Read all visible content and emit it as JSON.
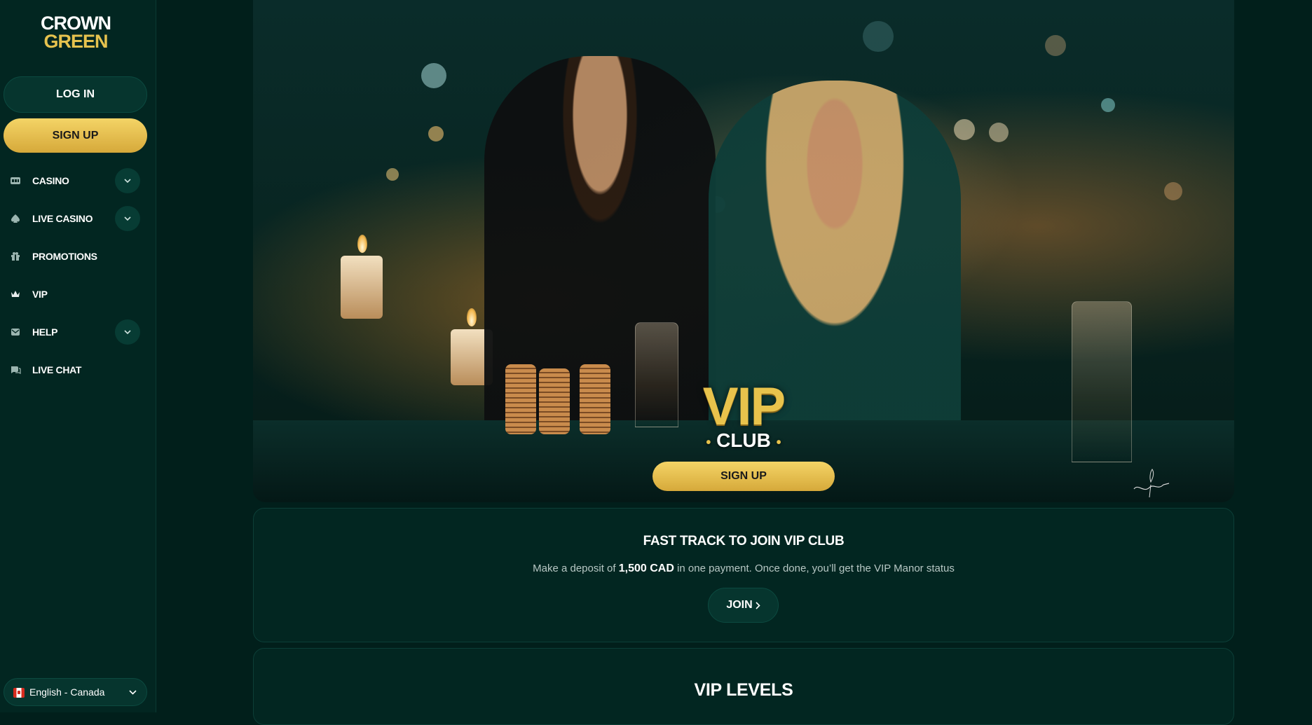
{
  "sidebar": {
    "logo": {
      "line1": "CROWN",
      "line2": "GREEN"
    },
    "login_label": "LOG IN",
    "signup_label": "SIGN UP",
    "items": [
      {
        "label": "CASINO",
        "icon": "slot-machine-icon",
        "has_dropdown": true
      },
      {
        "label": "LIVE CASINO",
        "icon": "spade-icon",
        "has_dropdown": true
      },
      {
        "label": "PROMOTIONS",
        "icon": "gift-icon",
        "has_dropdown": false
      },
      {
        "label": "VIP",
        "icon": "crown-icon",
        "has_dropdown": false
      },
      {
        "label": "HELP",
        "icon": "mail-icon",
        "has_dropdown": true
      },
      {
        "label": "LIVE CHAT",
        "icon": "chat-icon",
        "has_dropdown": false
      }
    ],
    "language": {
      "label": "English - Canada",
      "flag": "canada-flag"
    }
  },
  "hero": {
    "vip_text": "VIP",
    "club_text": "CLUB",
    "signup_label": "SIGN UP",
    "signature": "Crown"
  },
  "fast_track": {
    "title": "FAST TRACK TO JOIN VIP CLUB",
    "desc_before": "Make a deposit of",
    "desc_amount": "1,500 CAD",
    "desc_after": "in one payment. Once done, you’ll get the VIP Manor status",
    "join_label": "JOIN",
    "join_icon": "chevron-right-icon"
  },
  "vip_levels": {
    "title": "VIP LEVELS"
  },
  "colors": {
    "background": "#011f1b",
    "sidebar": "#022621",
    "gold": "#e6c24e",
    "button_dark": "#06352e"
  }
}
